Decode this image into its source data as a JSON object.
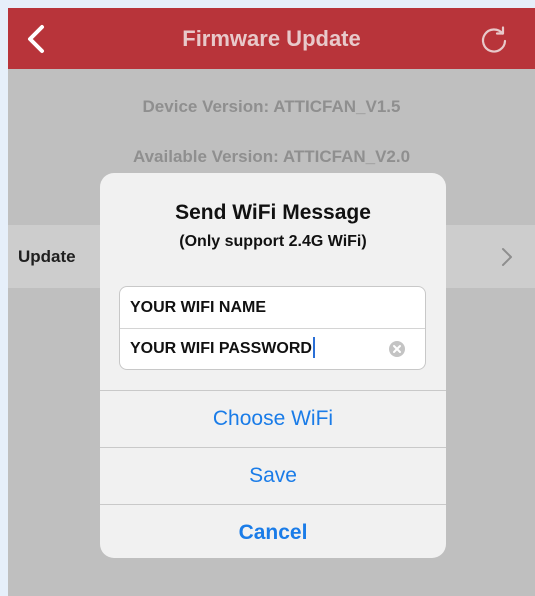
{
  "colors": {
    "navbar": "#b8343a",
    "overlay_background": "#bfbfbf",
    "dialog_background": "#f1f1f1",
    "action_blue": "#1a7ce8"
  },
  "navbar": {
    "title": "Firmware Update",
    "back_icon": "chevron-left-icon",
    "refresh_icon": "refresh-icon"
  },
  "device_info": {
    "device_version": "Device Version: ATTICFAN_V1.5",
    "available_version": "Available Version: ATTICFAN_V2.0"
  },
  "update_row": {
    "label": "Update",
    "chevron_icon": "chevron-right-icon"
  },
  "dialog": {
    "title": "Send WiFi Message",
    "subtitle": "(Only support 2.4G WiFi)",
    "wifi_name_value": "YOUR WIFI NAME",
    "wifi_password_value": "YOUR WIFI PASSWORD",
    "clear_icon": "clear-icon",
    "buttons": {
      "choose_wifi": "Choose WiFi",
      "save": "Save",
      "cancel": "Cancel"
    }
  }
}
